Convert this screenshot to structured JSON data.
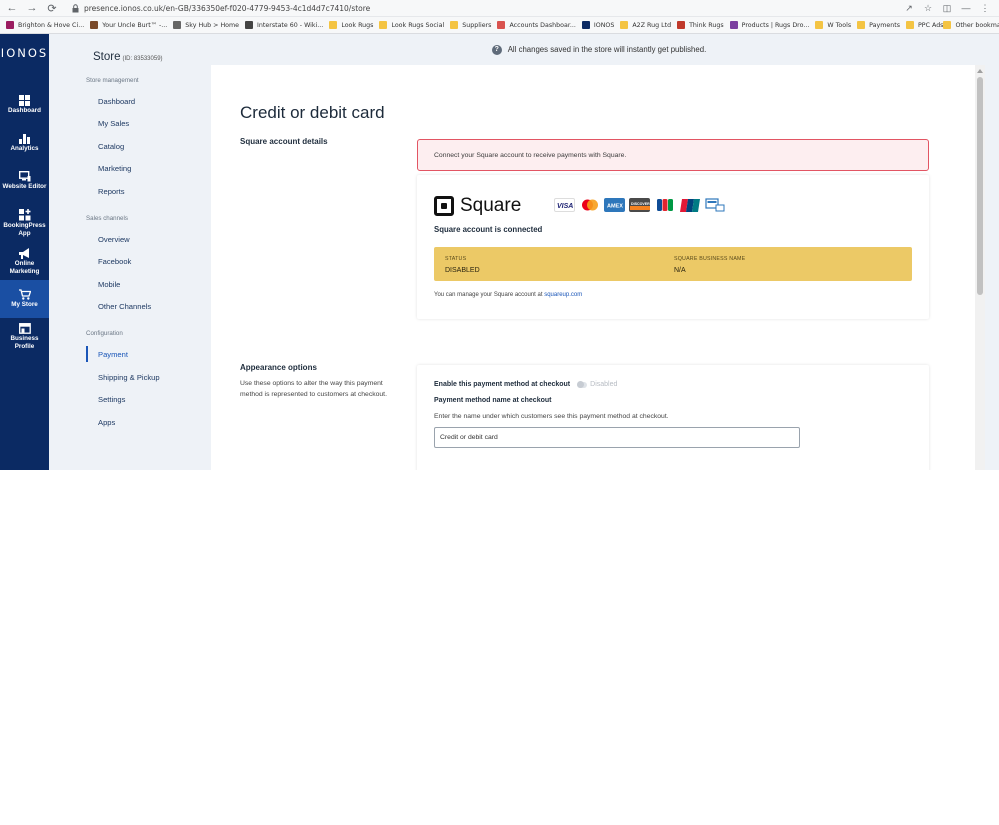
{
  "browser": {
    "url": "presence.ionos.co.uk/en-GB/336350ef-f020-4779-9453-4c1d4d7c7410/store",
    "bookmarks": [
      {
        "label": "Brighton & Hove Ci...",
        "color": "#9b1c60"
      },
      {
        "label": "Your Uncle Burt™ -...",
        "color": "#7a4a2a"
      },
      {
        "label": "Sky Hub > Home",
        "color": "#666666"
      },
      {
        "label": "Interstate 60 - Wiki...",
        "color": "#444444"
      },
      {
        "label": "Look Rugs",
        "color": "#f4c443"
      },
      {
        "label": "Look Rugs Social",
        "color": "#f4c443"
      },
      {
        "label": "Suppliers",
        "color": "#f4c443"
      },
      {
        "label": "Accounts Dashboar...",
        "color": "#d9534f"
      },
      {
        "label": "IONOS",
        "color": "#0b2a63"
      },
      {
        "label": "A2Z Rug Ltd",
        "color": "#f4c443"
      },
      {
        "label": "Think Rugs",
        "color": "#c0392b"
      },
      {
        "label": "Products | Rugs Dro...",
        "color": "#7b3fa0"
      },
      {
        "label": "W Tools",
        "color": "#f4c443"
      },
      {
        "label": "Payments",
        "color": "#f4c443"
      },
      {
        "label": "PPC Ads",
        "color": "#f4c443"
      }
    ],
    "other_bookmarks": "Other bookmarks"
  },
  "rail": {
    "logo": "IONOS",
    "items": [
      {
        "label": "Dashboard",
        "icon": "grid-icon"
      },
      {
        "label": "Analytics",
        "icon": "bar-chart-icon"
      },
      {
        "label": "Website Editor",
        "icon": "monitor-icon"
      },
      {
        "label": "BookingPress App",
        "icon": "apps-plus-icon"
      },
      {
        "label": "Online Marketing",
        "icon": "megaphone-icon"
      },
      {
        "label": "My Store",
        "icon": "cart-icon"
      },
      {
        "label": "Business Profile",
        "icon": "store-front-icon"
      }
    ]
  },
  "subnav": {
    "store_title": "Store",
    "store_id": "(ID: 83533059)",
    "sections": [
      {
        "title": "Store management",
        "items": [
          "Dashboard",
          "My Sales",
          "Catalog",
          "Marketing",
          "Reports"
        ]
      },
      {
        "title": "Sales channels",
        "items": [
          "Overview",
          "Facebook",
          "Mobile",
          "Other Channels"
        ]
      },
      {
        "title": "Configuration",
        "items": [
          "Payment",
          "Shipping & Pickup",
          "Settings",
          "Apps"
        ]
      }
    ]
  },
  "banner": {
    "text": "All changes saved in the store will instantly get published."
  },
  "main": {
    "title": "Credit or debit card",
    "square_section_label": "Square account details",
    "alert_text": "Connect your Square account to receive payments with Square.",
    "square_wordmark": "Square",
    "card_brands": [
      {
        "name": "VISA",
        "color": "#ffffff"
      },
      {
        "name": "Mastercard",
        "color": "#ffffff"
      },
      {
        "name": "AMEX",
        "color": "#2e77bb"
      },
      {
        "name": "DISCOVER",
        "color": "#4a4a4a"
      },
      {
        "name": "JCB",
        "color": "#ffffff"
      },
      {
        "name": "UnionPay",
        "color": "#ffffff"
      },
      {
        "name": "Other",
        "color": "#ffffff"
      }
    ],
    "connected_text": "Square account is connected",
    "status": {
      "status_label": "STATUS",
      "status_value": "DISABLED",
      "business_label": "SQUARE BUSINESS NAME",
      "business_value": "N/A",
      "color": "#ecc966"
    },
    "manage_prefix": "You can manage your Square account at",
    "manage_link": "squareup.com",
    "appearance": {
      "label": "Appearance options",
      "description": "Use these options to alter the way this payment method is represented to customers at checkout.",
      "enable_label": "Enable this payment method at checkout",
      "toggle_state": "Disabled",
      "name_label": "Payment method name at checkout",
      "name_help": "Enter the name under which customers see this payment method at checkout.",
      "name_value": "Credit or debit card"
    }
  }
}
